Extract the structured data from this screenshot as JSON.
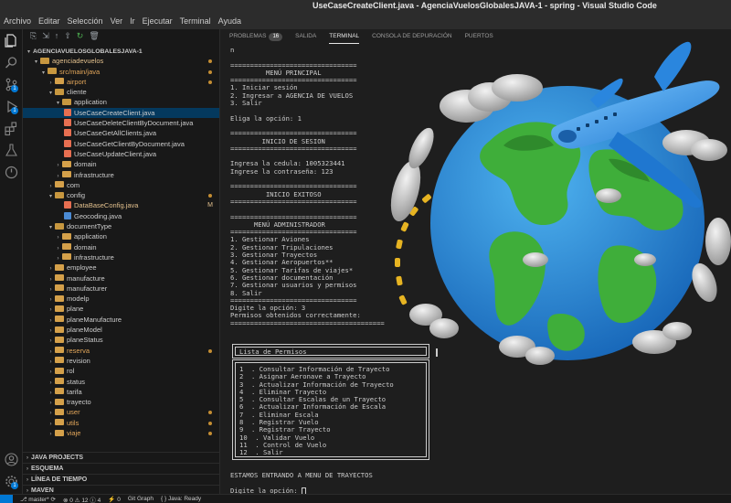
{
  "window": {
    "title": "UseCaseCreateClient.java - AgenciaVuelosGlobalesJAVA-1 - spring - Visual Studio Code"
  },
  "menu": [
    "Archivo",
    "Editar",
    "Selección",
    "Ver",
    "Ir",
    "Ejecutar",
    "Terminal",
    "Ayuda"
  ],
  "activity": {
    "badges": {
      "source_control": "1",
      "run": "1",
      "accounts": "1"
    }
  },
  "explorer": {
    "root": "AGENCIAVUELOSGLOBALESJAVA-1",
    "tree": [
      {
        "label": "agenciadevuelos"
      },
      {
        "label": "src/main/java"
      },
      {
        "label": "airport"
      },
      {
        "label": "cliente"
      },
      {
        "label": "application"
      },
      {
        "label": "UseCaseCreateClient.java"
      },
      {
        "label": "UseCaseDeleteClientByDocument.java"
      },
      {
        "label": "UseCaseGetAllClients.java"
      },
      {
        "label": "UseCaseGetClientByDocument.java"
      },
      {
        "label": "UseCaseUpdateClient.java"
      },
      {
        "label": "domain"
      },
      {
        "label": "infrastructure"
      },
      {
        "label": "com"
      },
      {
        "label": "config"
      },
      {
        "label": "DataBaseConfig.java",
        "mark": "M"
      },
      {
        "label": "Geocoding.java"
      },
      {
        "label": "documentType"
      },
      {
        "label": "application"
      },
      {
        "label": "domain"
      },
      {
        "label": "infrastructure"
      },
      {
        "label": "employee"
      },
      {
        "label": "manufacture"
      },
      {
        "label": "manufacturer"
      },
      {
        "label": "modelp"
      },
      {
        "label": "plane"
      },
      {
        "label": "planeManufacture"
      },
      {
        "label": "planeModel"
      },
      {
        "label": "planeStatus"
      },
      {
        "label": "reserva"
      },
      {
        "label": "revision"
      },
      {
        "label": "rol"
      },
      {
        "label": "status"
      },
      {
        "label": "tarifa"
      },
      {
        "label": "trayecto"
      },
      {
        "label": "user"
      },
      {
        "label": "utils"
      },
      {
        "label": "viaje"
      }
    ],
    "sections": [
      "JAVA PROJECTS",
      "ESQUEMA",
      "LÍNEA DE TIEMPO",
      "MAVEN"
    ]
  },
  "panel": {
    "tabs": [
      {
        "label": "PROBLEMAS",
        "badge": "16"
      },
      {
        "label": "SALIDA"
      },
      {
        "label": "TERMINAL"
      },
      {
        "label": "CONSOLA DE DEPURACIÓN"
      },
      {
        "label": "PUERTOS"
      }
    ],
    "active_tab": "TERMINAL"
  },
  "terminal": {
    "lines": [
      "n",
      "",
      "================================",
      "         MENÚ PRINCIPAL",
      "================================",
      "1. Iniciar sesión",
      "2. Ingresar a AGENCIA DE VUELOS",
      "3. Salir",
      "",
      "Eliga la opción: 1",
      "",
      "================================",
      "        INICIO DE SESION",
      "================================",
      "",
      "Ingresa la cedula: 1005323441",
      "Ingrese la contraseña: 123",
      "",
      "================================",
      "         INICIO EXITOSO",
      "================================",
      "",
      "================================",
      "      MENÚ ADMINISTRADOR",
      "================================",
      "1. Gestionar Aviones",
      "2. Gestionar Tripulaciones",
      "3. Gestionar Trayectos",
      "4. Gestionar Aeropuertos**",
      "5. Gestionar Tarifas de viajes*",
      "6. Gestionar documentación",
      "7. Gestionar usuarios y permisos",
      "8. Salir",
      "================================",
      "Digite la opción: 3",
      "Permisos obtenidos correctamente:",
      "======================================="
    ],
    "permissions_title": "Lista de Permisos",
    "permissions": [
      "1  . Consultar Información de Trayecto",
      "2  . Asignar Aeronave a Trayecto",
      "3  . Actualizar Información de Trayecto",
      "4  . Eliminar Trayecto",
      "5  . Consultar Escalas de un Trayecto",
      "6  . Actualizar Información de Escala",
      "7  . Eliminar Escala",
      "8  . Registrar Vuelo",
      "9  . Registrar Trayecto",
      "10  . Validar Vuelo",
      "11  . Control de Vuelo",
      "12  . Salir"
    ],
    "after_lines": [
      "ESTAMOS ENTRANDO A MENU DE TRAYECTOS",
      "",
      "Digite la opción: "
    ]
  },
  "statusbar": {
    "branch": "master*",
    "errors": "0",
    "warnings": "12",
    "info": "4",
    "remote_count": "0",
    "git_graph": "Git Graph",
    "java_status": "Java: Ready"
  },
  "colors": {
    "accent": "#0078d4",
    "folder": "#d4a04a",
    "java_file": "#e76f51",
    "modified": "#e2c08d"
  }
}
